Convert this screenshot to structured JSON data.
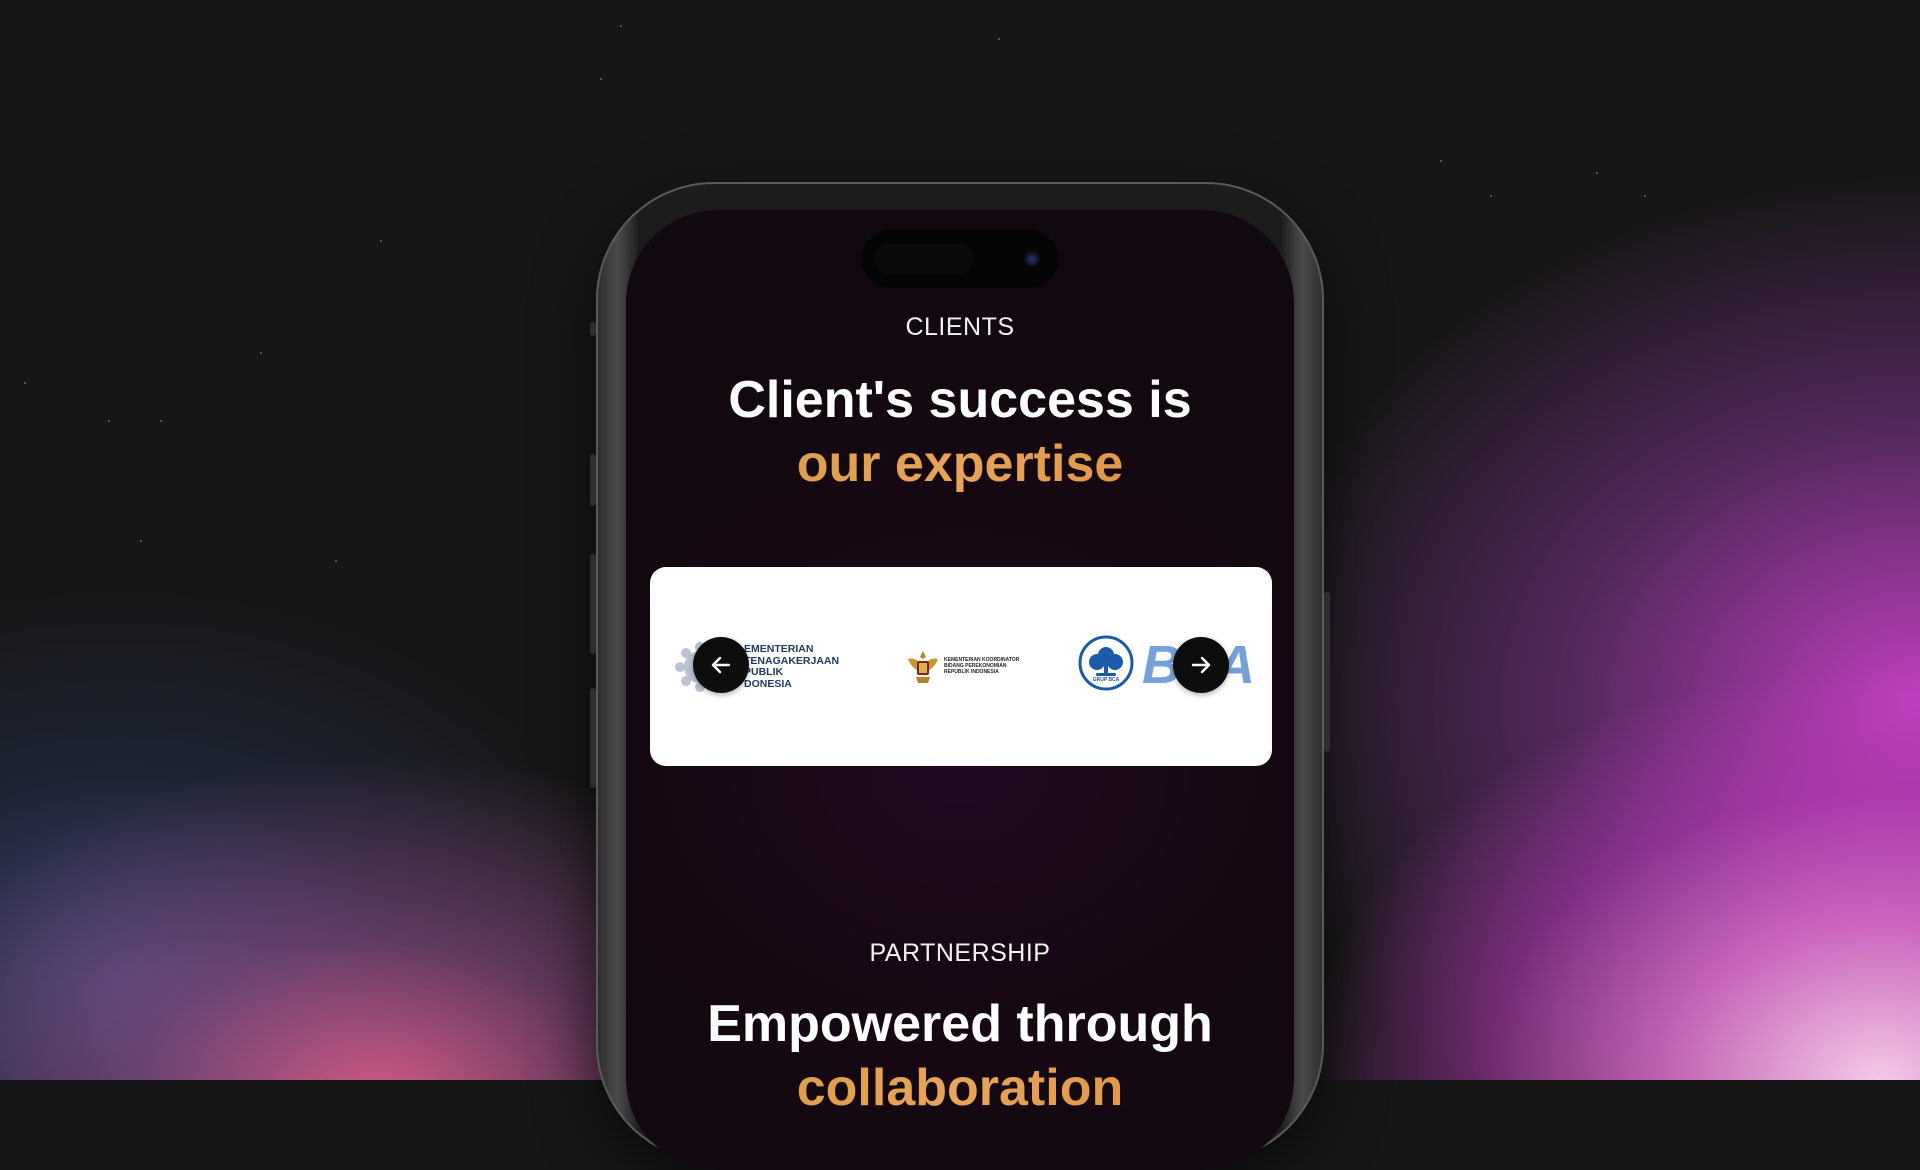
{
  "colors": {
    "accent_gradient_start": "#d39a3f",
    "accent_gradient_end": "#d98a3a",
    "screen_background": "#160812",
    "carousel_background": "#ffffff",
    "nav_button": "#0d0d0d"
  },
  "clients": {
    "eyebrow": "CLIENTS",
    "headline_line1": "Client's success is",
    "headline_accent": "our expertise",
    "logos": [
      {
        "name": "Kementerian Ketenagakerjaan Republik Indonesia",
        "lines": [
          "EMENTERIAN",
          "TENAGAKERJAAN",
          "PUBLIK",
          "DONESIA"
        ]
      },
      {
        "name": "Kementerian Koordinator Bidang Perekonomian",
        "lines": [
          "KEMENTERIAN KOORDINATOR",
          "BIDANG PEREKONOMIAN",
          "REPUBLIK INDONESIA"
        ]
      },
      {
        "name": "Grup BCA",
        "badge_text": "GRUP BCA",
        "word": "BCA"
      }
    ],
    "prev_icon": "arrow-left-icon",
    "next_icon": "arrow-right-icon"
  },
  "partnership": {
    "eyebrow": "PARTNERSHIP",
    "headline_line1": "Empowered through",
    "headline_accent": "collaboration"
  }
}
